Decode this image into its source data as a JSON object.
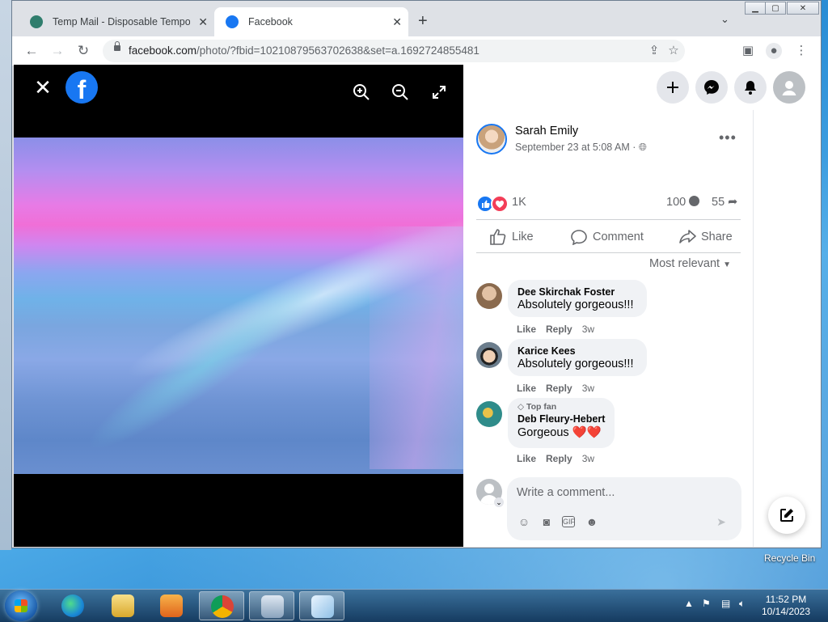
{
  "browser": {
    "tabs": [
      {
        "title": "Temp Mail - Disposable Tempora",
        "active": false,
        "favicon": "tempmail-icon"
      },
      {
        "title": "Facebook",
        "active": true,
        "favicon": "facebook-icon"
      }
    ],
    "close_glyph": "✕",
    "new_tab": "+",
    "url_host": "facebook.com",
    "url_path": "/photo/?fbid=10210879563702638&set=a.1692724855481"
  },
  "viewer": {
    "close": "✕",
    "logo": "f"
  },
  "post": {
    "author": "Sarah Emily",
    "timestamp": "September 23 at 5:08 AM ·",
    "reaction_count": "1K",
    "comment_count": "100",
    "share_count": "55",
    "more": "•••",
    "actions": {
      "like": "Like",
      "comment": "Comment",
      "share": "Share"
    },
    "sort_label": "Most relevant"
  },
  "comments": [
    {
      "name": "Dee Skirchak Foster",
      "text": "Absolutely gorgeous!!!",
      "like": "Like",
      "reply": "Reply",
      "time": "3w",
      "badge": ""
    },
    {
      "name": "Karice Kees",
      "text": "Absolutely gorgeous!!!",
      "like": "Like",
      "reply": "Reply",
      "time": "3w",
      "badge": ""
    },
    {
      "name": "Deb Fleury-Hebert",
      "text": "Gorgeous ❤️❤️",
      "like": "Like",
      "reply": "Reply",
      "time": "3w",
      "badge": "Top fan"
    }
  ],
  "composer": {
    "placeholder": "Write a comment...",
    "chevron": "⌄"
  },
  "desktop": {
    "recycle_bin": "Recycle Bin"
  },
  "taskbar": {
    "time": "11:52 PM",
    "date": "10/14/2023"
  },
  "colors": {
    "facebook_blue": "#1877f2",
    "love_red": "#f33e58"
  }
}
